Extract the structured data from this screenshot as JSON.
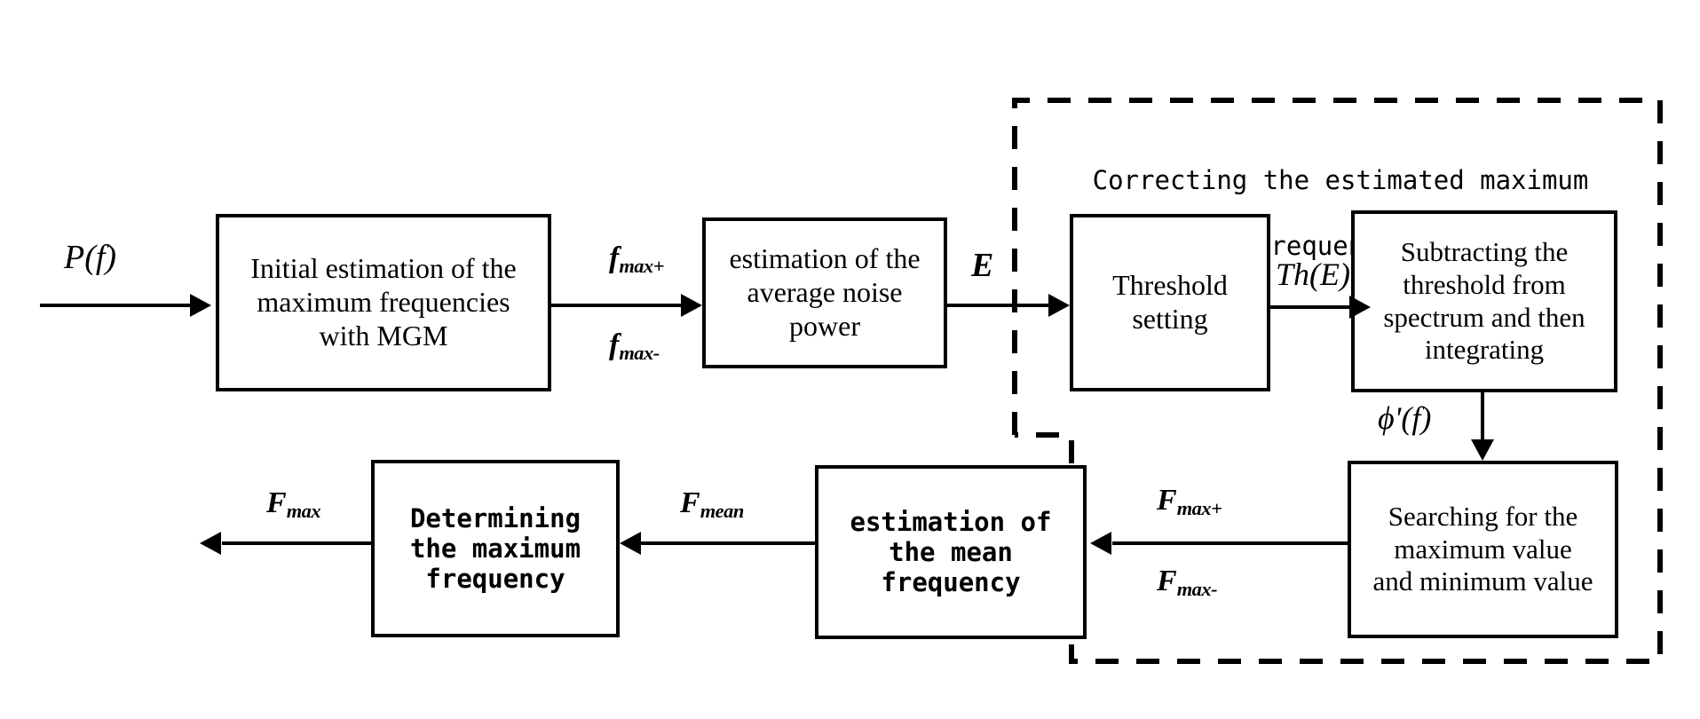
{
  "diagram": {
    "title": "Correcting the estimated maximum frequencies",
    "group": {
      "label_line1": "Correcting the estimated maximum",
      "label_line2": "frequencies",
      "style": "dashed"
    },
    "boxes": {
      "initial_estimation": "Initial estimation of the maximum frequencies with MGM",
      "noise_power": "estimation of the average noise power",
      "threshold_setting": "Threshold setting",
      "subtract_integrate": "Subtracting the threshold from spectrum and then integrating",
      "searching": "Searching for the maximum value and minimum value",
      "mean_frequency": "estimation of the mean frequency",
      "determining": "Determining the maximum frequency"
    },
    "box_lines": {
      "initial_estimation": [
        "Initial estimation of the",
        "maximum frequencies",
        "with MGM"
      ],
      "noise_power": [
        "estimation of the",
        "average noise",
        "power"
      ],
      "threshold_setting": [
        "Threshold",
        "setting"
      ],
      "subtract_integrate": [
        "Subtracting the",
        "threshold from",
        "spectrum and then",
        "integrating"
      ],
      "searching": [
        "Searching for the",
        "maximum value",
        "and minimum value"
      ],
      "mean_frequency": [
        "estimation of",
        "the mean",
        "frequency"
      ],
      "determining": [
        "Determining",
        "the maximum",
        "frequency"
      ]
    },
    "signals": {
      "input_power_spectrum": "P(f)",
      "f_max_plus": "f",
      "f_max_plus_sub": "max+",
      "f_max_minus": "f",
      "f_max_minus_sub": "max-",
      "noise_energy": "E",
      "threshold": "Th(E)",
      "phi_prime": "ϕ'(f)",
      "F_max_plus": "F",
      "F_max_plus_sub": "max+",
      "F_max_minus": "F",
      "F_max_minus_sub": "max-",
      "F_mean": "F",
      "F_mean_sub": "mean",
      "F_max_out": "F",
      "F_max_out_sub": "max"
    },
    "colors": {
      "stroke": "#000000",
      "background": "#ffffff"
    }
  }
}
